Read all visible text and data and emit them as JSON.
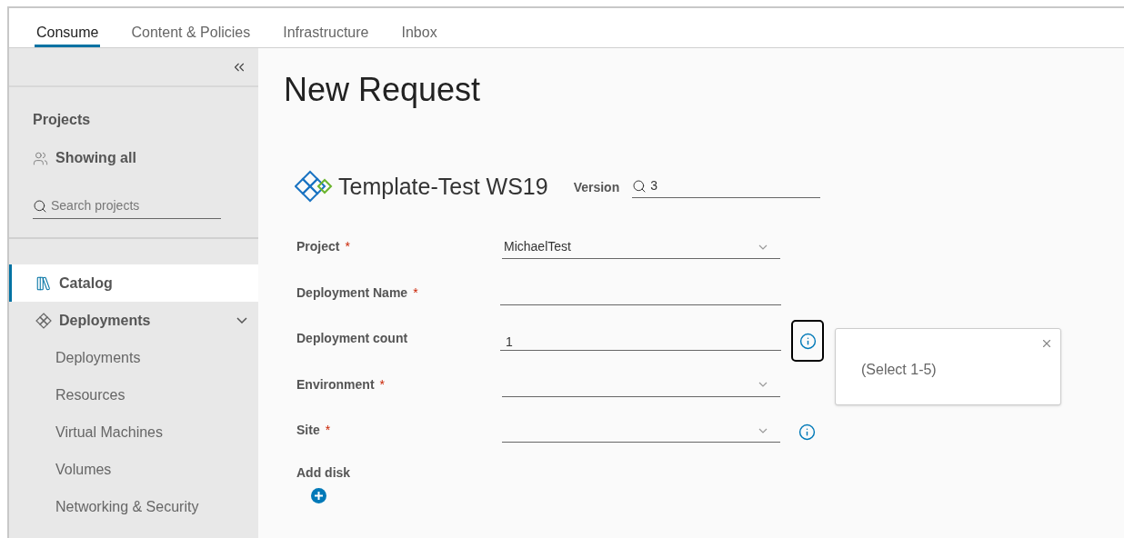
{
  "tabs": [
    {
      "label": "Consume",
      "selected": true
    },
    {
      "label": "Content & Policies",
      "selected": false
    },
    {
      "label": "Infrastructure",
      "selected": false
    },
    {
      "label": "Inbox",
      "selected": false
    }
  ],
  "sidebar": {
    "projects_title": "Projects",
    "projects_filter": "Showing all",
    "search": {
      "placeholder": "Search projects"
    },
    "items": [
      {
        "label": "Catalog",
        "kind": "catalog",
        "selected": true
      },
      {
        "label": "Deployments",
        "kind": "deployments",
        "selected": false,
        "expanded": true,
        "children": [
          {
            "label": "Deployments",
            "selected": false
          },
          {
            "label": "Resources",
            "selected": false
          },
          {
            "label": "Virtual Machines",
            "selected": false
          },
          {
            "label": "Volumes",
            "selected": false
          },
          {
            "label": "Networking & Security",
            "selected": false
          }
        ]
      }
    ]
  },
  "page_title": "New Request",
  "template": {
    "name": "Template-Test WS19",
    "version_label": "Version",
    "version_value": "3"
  },
  "fields": [
    {
      "label": "Project",
      "required_mark": "*",
      "kind": "select",
      "value": "MichaelTest"
    },
    {
      "label": "Deployment Name",
      "required_mark": "*",
      "kind": "text"
    },
    {
      "label": "Deployment count",
      "kind": "text",
      "value": "1",
      "info": {
        "focused": true
      }
    },
    {
      "label": "Environment",
      "required_mark": "*",
      "kind": "select"
    },
    {
      "label": "Site",
      "required_mark": "*",
      "kind": "select",
      "info": {
        "focused": false
      }
    }
  ],
  "add_disk": {
    "label": "Add disk"
  },
  "tooltip": {
    "text": "(Select 1-5)"
  }
}
